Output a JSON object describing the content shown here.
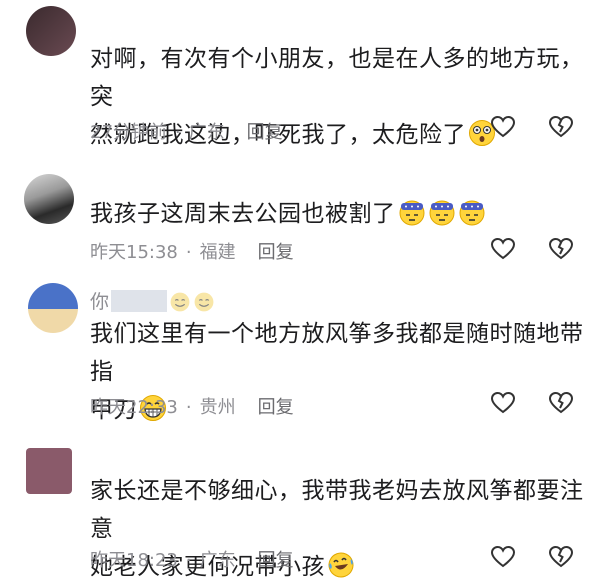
{
  "comments": [
    {
      "name": "",
      "text_line1": "对啊，有次有个小朋友，也是在人多的地方玩，突",
      "text_line2": "然就跑我这边，吓死我了，太危险了",
      "time": "27分钟前",
      "sep": "·",
      "region": "广东",
      "reply": "回复",
      "emoji": [
        "shocked-face-emoji"
      ]
    },
    {
      "name": "",
      "text_line1": "我孩子这周末去公园也被割了",
      "time": "昨天15:38",
      "sep": "·",
      "region": "福建",
      "reply": "回复",
      "emoji": [
        "bandaged-face-emoji",
        "bandaged-face-emoji",
        "bandaged-face-emoji"
      ]
    },
    {
      "name": "你",
      "text_line1": "我们这里有一个地方放风筝多我都是随时随地带指",
      "text_line2": "甲刀",
      "time": "昨天22:33",
      "sep": "·",
      "region": "贵州",
      "reply": "回复",
      "emoji": [
        "grin-face-emoji"
      ]
    },
    {
      "name": "",
      "text_line1": "家长还是不够细心，我带我老妈去放风筝都要注意",
      "text_line2": "她老人家更何况带小孩",
      "time": "昨天18:23",
      "sep": "·",
      "region": "广东",
      "reply": "回复",
      "emoji": [
        "laughing-tears-emoji"
      ]
    }
  ],
  "colors": {
    "text": "#1d1d1f",
    "meta": "#8e8e93",
    "icon": "#333333"
  }
}
